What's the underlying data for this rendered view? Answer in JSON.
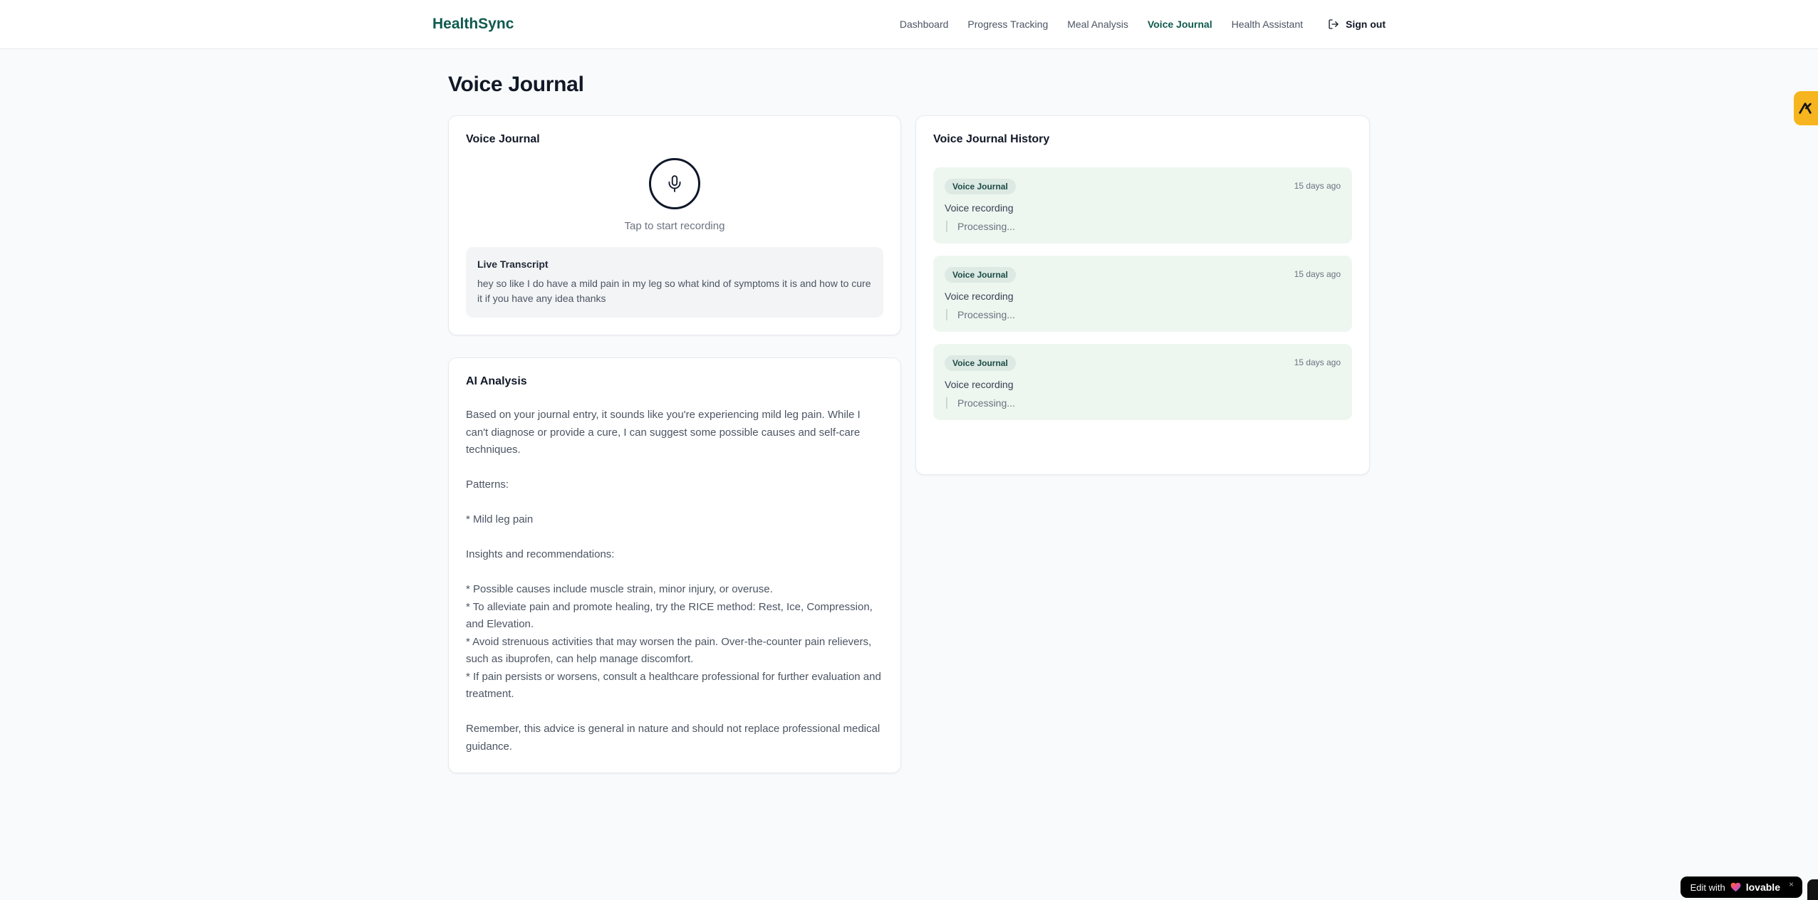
{
  "brand": {
    "name": "HealthSync"
  },
  "nav": {
    "items": [
      {
        "label": "Dashboard",
        "active": false
      },
      {
        "label": "Progress Tracking",
        "active": false
      },
      {
        "label": "Meal Analysis",
        "active": false
      },
      {
        "label": "Voice Journal",
        "active": true
      },
      {
        "label": "Health Assistant",
        "active": false
      }
    ],
    "sign_out_label": "Sign out"
  },
  "page": {
    "title": "Voice Journal"
  },
  "recorder_card": {
    "title": "Voice Journal",
    "tap_hint": "Tap to start recording",
    "transcript_title": "Live Transcript",
    "transcript_text": "hey so like I do have a mild pain in my leg so what kind of symptoms it is and how to cure it if you have any idea thanks"
  },
  "analysis_card": {
    "title": "AI Analysis",
    "body": "Based on your journal entry, it sounds like you're experiencing mild leg pain. While I can't diagnose or provide a cure, I can suggest some possible causes and self-care techniques.\n\nPatterns:\n\n* Mild leg pain\n\nInsights and recommendations:\n\n* Possible causes include muscle strain, minor injury, or overuse.\n* To alleviate pain and promote healing, try the RICE method: Rest, Ice, Compression, and Elevation.\n* Avoid strenuous activities that may worsen the pain. Over-the-counter pain relievers, such as ibuprofen, can help manage discomfort.\n* If pain persists or worsens, consult a healthcare professional for further evaluation and treatment.\n\nRemember, this advice is general in nature and should not replace professional medical guidance."
  },
  "history_card": {
    "title": "Voice Journal History",
    "entries": [
      {
        "badge": "Voice Journal",
        "time": "15 days ago",
        "title": "Voice recording",
        "status": "Processing..."
      },
      {
        "badge": "Voice Journal",
        "time": "15 days ago",
        "title": "Voice recording",
        "status": "Processing..."
      },
      {
        "badge": "Voice Journal",
        "time": "15 days ago",
        "title": "Voice recording",
        "status": "Processing..."
      }
    ]
  },
  "floating": {
    "edit_badge": {
      "prefix": "Edit with",
      "brand": "lovable",
      "close": "×"
    }
  },
  "icons": {
    "mic": "mic-icon",
    "sign_out": "logout-icon",
    "heart": "heart-icon",
    "close": "close-icon",
    "brand_badge": "lambda-icon"
  },
  "colors": {
    "accent": "#0e5a4e",
    "amber_badge": "#f6b51e",
    "entry_bg": "#eef6f0",
    "badge_bg": "#dde9e3",
    "badge_text": "#1b4a44",
    "transcript_bg": "#f3f4f6",
    "page_bg": "#f9fafb"
  }
}
